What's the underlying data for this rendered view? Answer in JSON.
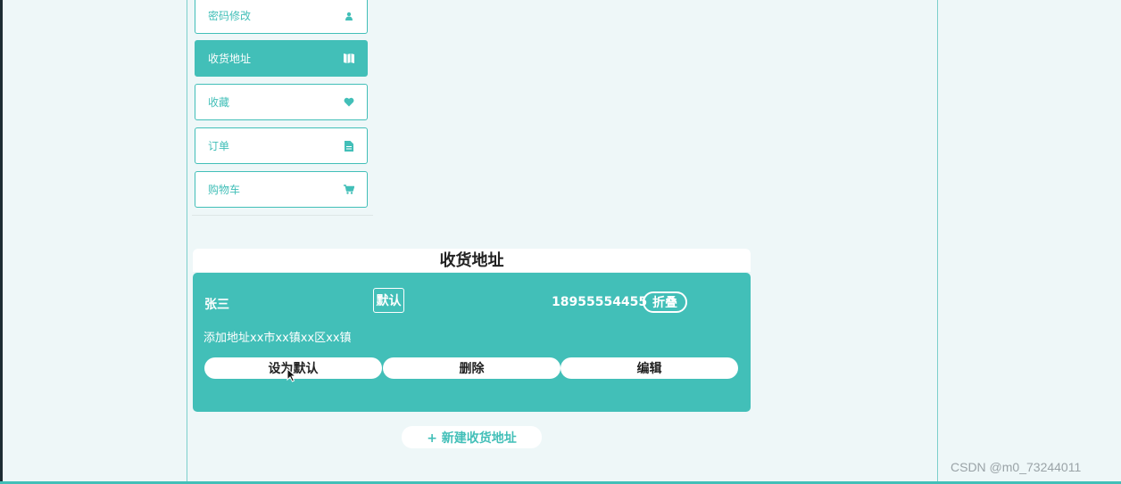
{
  "sidebar": {
    "items": [
      {
        "label": "密码修改",
        "icon": "user-icon",
        "active": false
      },
      {
        "label": "收货地址",
        "icon": "map-icon",
        "active": true
      },
      {
        "label": "收藏",
        "icon": "heart-icon",
        "active": false
      },
      {
        "label": "订单",
        "icon": "document-icon",
        "active": false
      },
      {
        "label": "购物车",
        "icon": "cart-icon",
        "active": false
      }
    ]
  },
  "address_section": {
    "title": "收货地址",
    "card": {
      "name": "张三",
      "default_badge": "默认",
      "phone": "18955554455",
      "collapse_label": "折叠",
      "detail": "添加地址xx市xx镇xx区xx镇",
      "actions": {
        "set_default": "设为默认",
        "delete": "删除",
        "edit": "编辑"
      }
    },
    "new_address_label": "+ 新建收货地址"
  },
  "watermark": "CSDN @m0_73244011",
  "colors": {
    "accent": "#42bfb8",
    "background": "#eef7f8",
    "text_dark": "#222222"
  }
}
